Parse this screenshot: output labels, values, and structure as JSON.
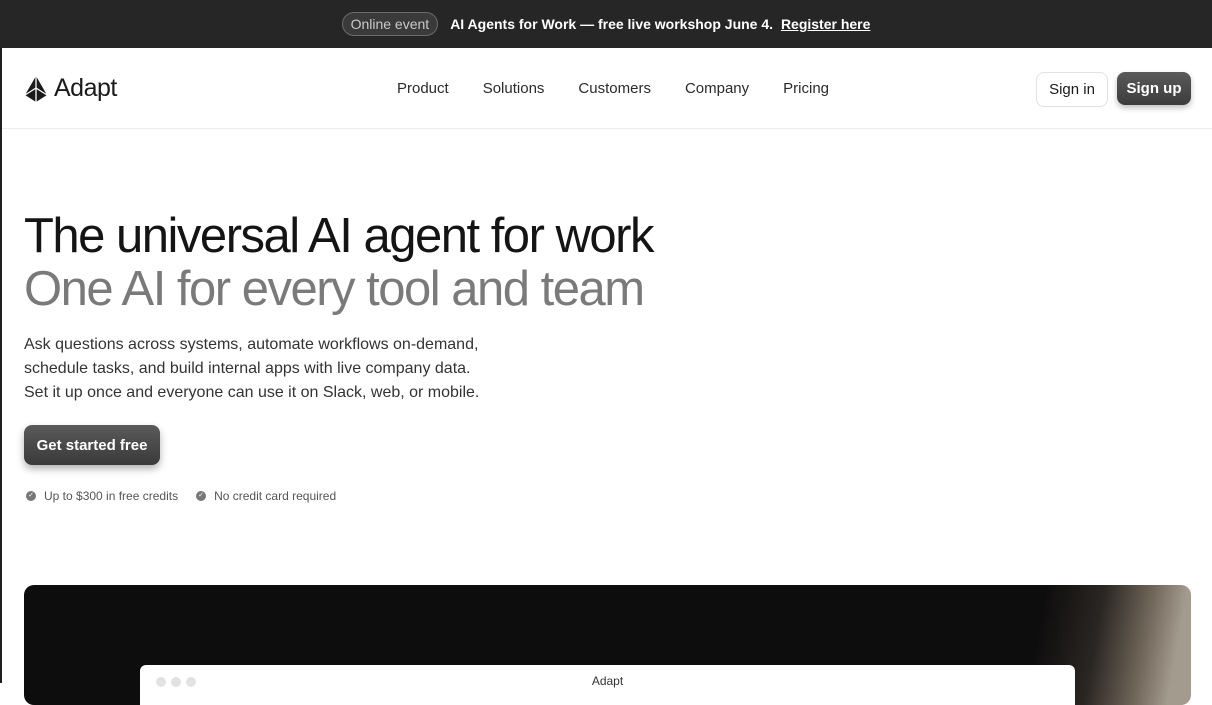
{
  "announcement": {
    "badge": "Online event",
    "text": "AI Agents for Work — free live workshop June 4.",
    "link": "Register here"
  },
  "header": {
    "logo_text": "Adapt",
    "nav": [
      "Product",
      "Solutions",
      "Customers",
      "Company",
      "Pricing"
    ],
    "sign_in": "Sign in",
    "sign_up": "Sign up"
  },
  "hero": {
    "title": "The universal AI agent for work",
    "subtitle": "One AI for every tool and team",
    "description_lines": [
      "Ask questions across systems, automate workflows on-demand,",
      "schedule tasks, and build internal apps with live company data.",
      "Set it up once and everyone can use it on Slack, web, or mobile."
    ],
    "cta": "Get started free",
    "perks": [
      "Up to $300 in free credits",
      "No credit card required"
    ]
  },
  "preview": {
    "window_title": "Adapt"
  },
  "icons": {
    "logo": "adapt-logo-icon",
    "check": "check-circle-icon"
  },
  "colors": {
    "announcement_bg": "#262626",
    "primary_button": "#4a4a4a",
    "subtitle_gray": "#7a7a7a"
  }
}
